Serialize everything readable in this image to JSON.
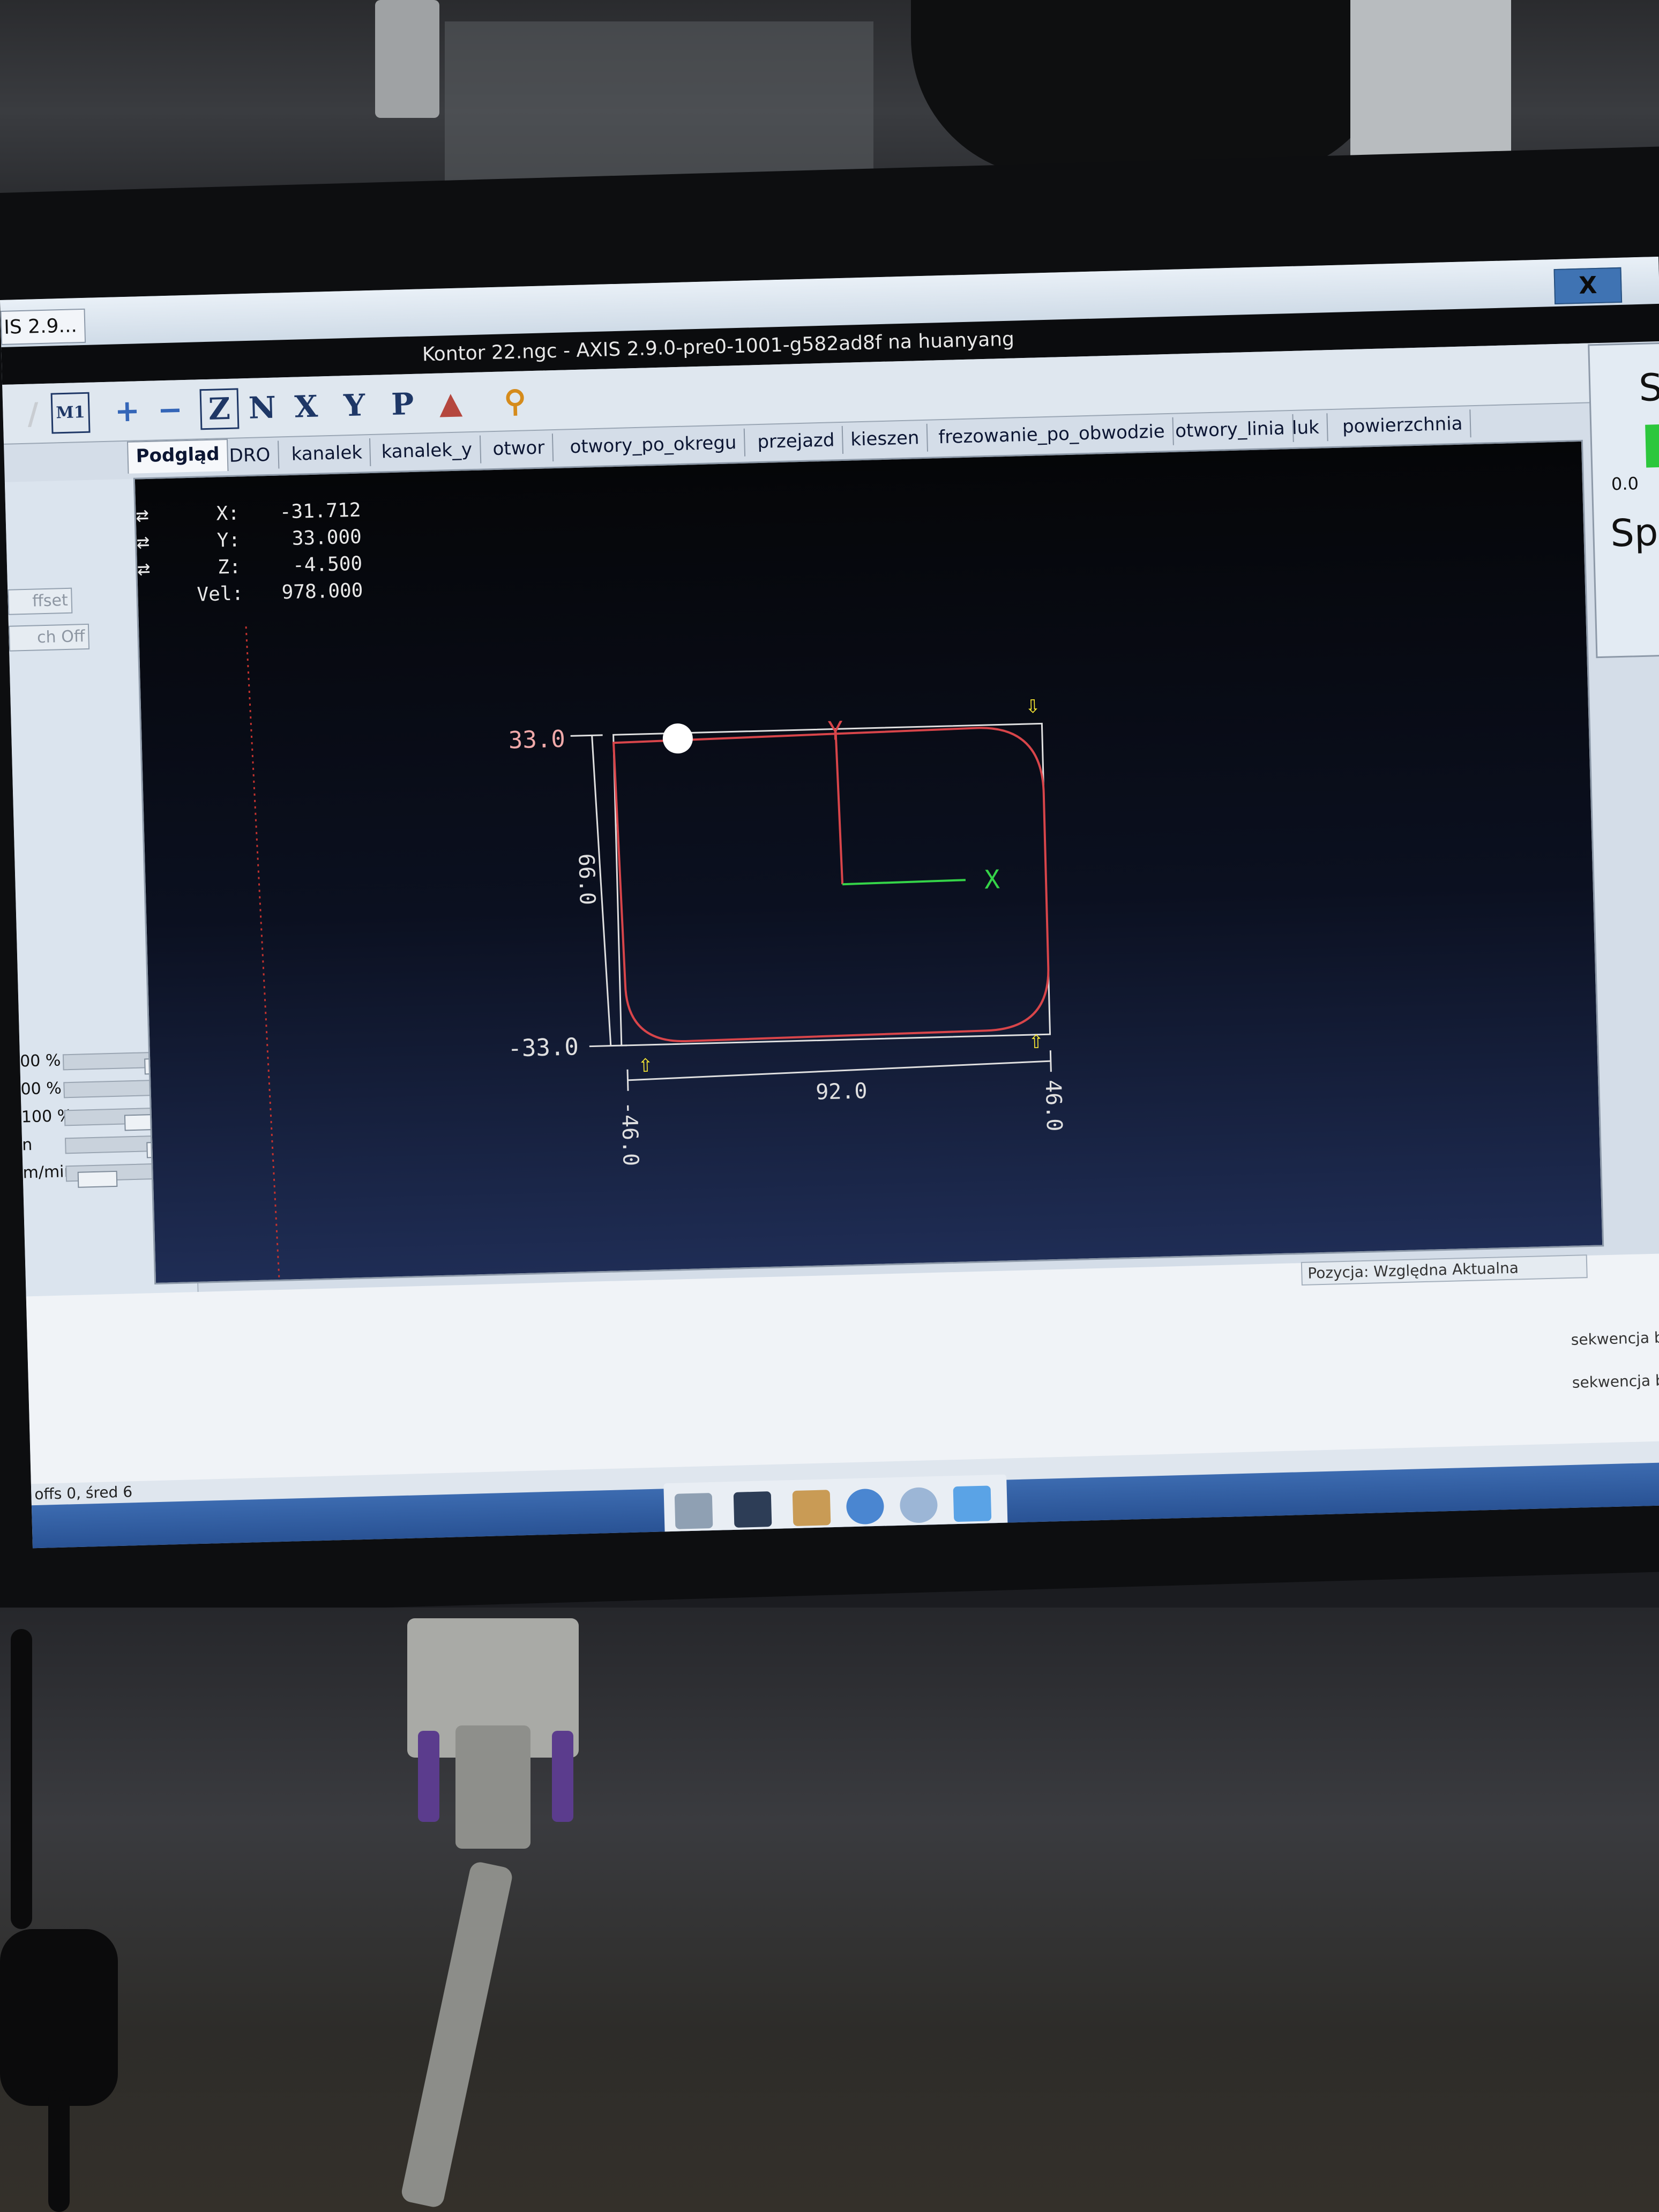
{
  "window": {
    "taskbar_tab": "IS 2.9...",
    "close": "X",
    "title": "Kontor 22.ngc - AXIS 2.9.0-pre0-1001-g582ad8f na huanyang"
  },
  "toolbar": {
    "buttons": [
      "Z",
      "N",
      "X",
      "Y",
      "P"
    ]
  },
  "tabs": [
    "Podgląd",
    "DRO",
    "kanalek",
    "kanalek_y",
    "otwor",
    "otwory_po_okregu",
    "przejazd",
    "kieszen",
    "frezowanie_po_obwodzie",
    "otwory_linia",
    "luk",
    "powierzchnia"
  ],
  "left_panel": {
    "offset_button": "ffset",
    "touch_off_button": "ch Off",
    "sliders": [
      {
        "label": "00 %",
        "level": 0.3
      },
      {
        "label": "00 %",
        "level": 0.35
      },
      {
        "label": "100 %",
        "level": 0.45
      },
      {
        "label": "n",
        "level": 0.35
      },
      {
        "label": "m/min",
        "level": 0.85
      }
    ]
  },
  "dro": {
    "x_label": "X:",
    "x": "-31.712",
    "y_label": "Y:",
    "y": "33.000",
    "z_label": "Z:",
    "z": "-4.500",
    "vel_label": "Vel:",
    "vel": "978.000"
  },
  "preview": {
    "ymax_label": "33.0",
    "ymin_label": "-33.0",
    "height_label": "66.0",
    "width_label": "92.0",
    "xmin_label": "-46.0",
    "xmax_label": "46.0",
    "x_axis": "X",
    "y_axis": "Y",
    "colors": {
      "toolpath": "#d8454a",
      "x_axis": "#35d448",
      "y_axis": "#d8454a",
      "dims": "#e0e0e0",
      "limits": "#ffee33"
    }
  },
  "right_panel": {
    "title_letter": "S",
    "value": "0.0",
    "spindle_label": "Spi"
  },
  "messages": [
    "sekwencja bazo",
    "sekwencja bazo"
  ],
  "status": {
    "position": "Pozycja: Względna Aktualna",
    "left": "offs 0, śred 6"
  }
}
